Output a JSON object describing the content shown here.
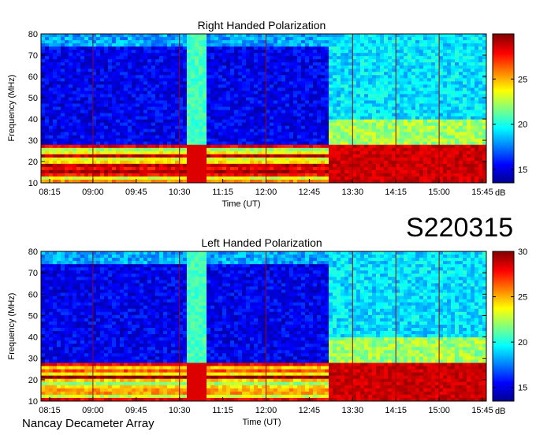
{
  "figure": {
    "event_id": "S220315",
    "footer": "Nancay Decameter Array"
  },
  "chart_data": [
    {
      "type": "heatmap",
      "title": "Right Handed Polarization",
      "xlabel": "Time (UT)",
      "ylabel": "Frequency (MHz)",
      "x_ticks": [
        "08:15",
        "09:00",
        "09:45",
        "10:30",
        "11:15",
        "12:00",
        "12:45",
        "13:30",
        "14:15",
        "15:00",
        "15:45"
      ],
      "y_ticks": [
        10,
        20,
        30,
        40,
        50,
        60,
        70,
        80
      ],
      "ylim": [
        10,
        80
      ],
      "colorbar": {
        "ticks": [
          15,
          20,
          25
        ],
        "range": [
          13.5,
          30
        ],
        "unit": "dB",
        "colormap": "jet"
      }
    },
    {
      "type": "heatmap",
      "title": "Left Handed Polarization",
      "xlabel": "Time (UT)",
      "ylabel": "Frequency (MHz)",
      "x_ticks": [
        "08:15",
        "09:00",
        "09:45",
        "10:30",
        "11:15",
        "12:00",
        "12:45",
        "13:30",
        "14:15",
        "15:00",
        "15:45"
      ],
      "y_ticks": [
        10,
        20,
        30,
        40,
        50,
        60,
        70,
        80
      ],
      "ylim": [
        10,
        80
      ],
      "colorbar": {
        "ticks": [
          15,
          20,
          25,
          30
        ],
        "range": [
          13.5,
          30
        ],
        "unit": "dB",
        "colormap": "jet"
      }
    }
  ],
  "colors": {
    "jet": [
      "#00008f",
      "#0000ff",
      "#0080ff",
      "#00ffff",
      "#80ff80",
      "#ffff00",
      "#ff8000",
      "#ff0000",
      "#800000"
    ]
  }
}
